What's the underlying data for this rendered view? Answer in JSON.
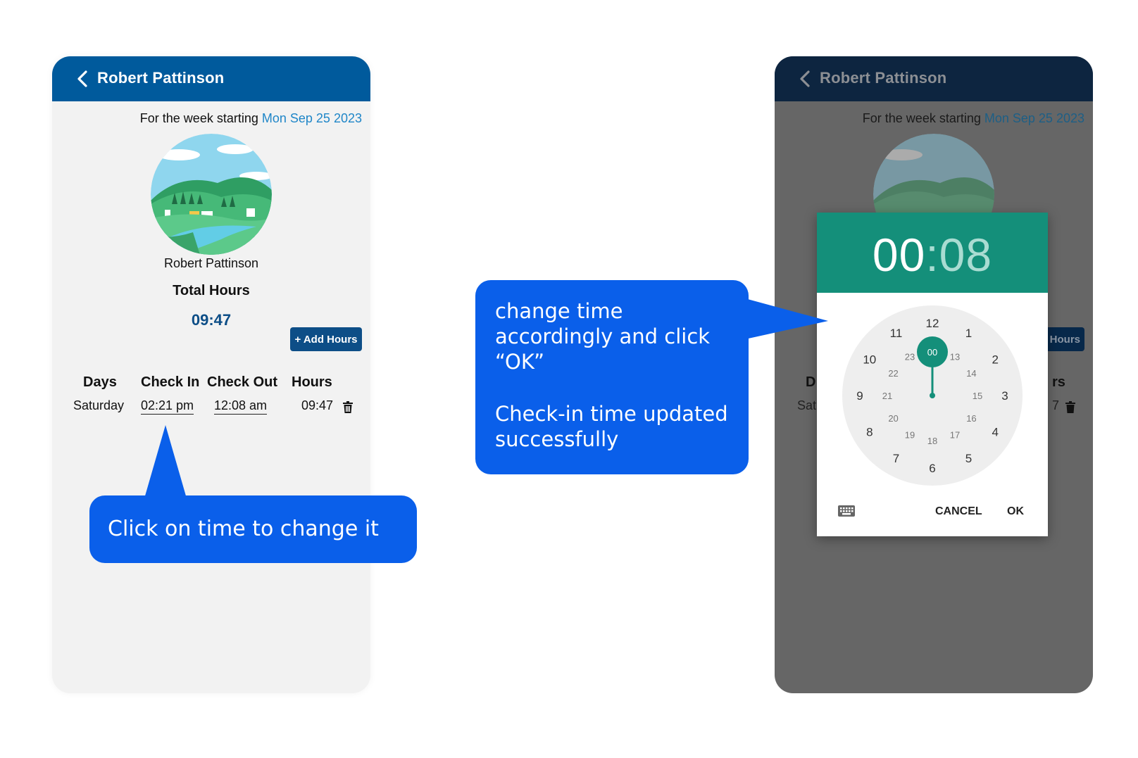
{
  "left_screen": {
    "header": {
      "title": "Robert  Pattinson"
    },
    "week": {
      "prefix": "For the week starting",
      "date": "Mon Sep 25 2023"
    },
    "profile": {
      "name": "Robert  Pattinson"
    },
    "totals": {
      "label": "Total Hours",
      "value": "09:47"
    },
    "add_hours_label": "+ Add Hours",
    "table": {
      "headers": [
        "Days",
        "Check In",
        "Check Out",
        "Hours"
      ],
      "rows": [
        {
          "day": "Saturday",
          "check_in": "02:21 pm",
          "check_out": "12:08 am",
          "hours": "09:47"
        }
      ]
    }
  },
  "right_screen": {
    "header": {
      "title": "Robert  Pattinson"
    },
    "week": {
      "prefix": "For the week starting",
      "date": "Mon Sep 25 2023"
    },
    "add_hours_label": "Hours",
    "partial_header_days": "D",
    "partial_header_hours": "rs",
    "partial_day": "Sat",
    "partial_hours": "7",
    "time_picker": {
      "hours": "00",
      "colon": ":",
      "minutes": "08",
      "selected": "00",
      "outer_numbers": [
        "12",
        "1",
        "2",
        "3",
        "4",
        "5",
        "6",
        "7",
        "8",
        "9",
        "10",
        "11"
      ],
      "inner_numbers": [
        "13",
        "14",
        "15",
        "16",
        "17",
        "18",
        "19",
        "20",
        "21",
        "22",
        "23"
      ],
      "cancel_label": "CANCEL",
      "ok_label": "OK"
    }
  },
  "callouts": {
    "left": "Click on time to change it",
    "right_line1": "change time accordingly and click “OK”",
    "right_line2": "Check-in time updated successfully"
  },
  "colors": {
    "header_blue": "#005a9c",
    "callout_blue": "#0a5fea",
    "picker_teal": "#148f7a",
    "accent_link": "#1f86c8"
  }
}
